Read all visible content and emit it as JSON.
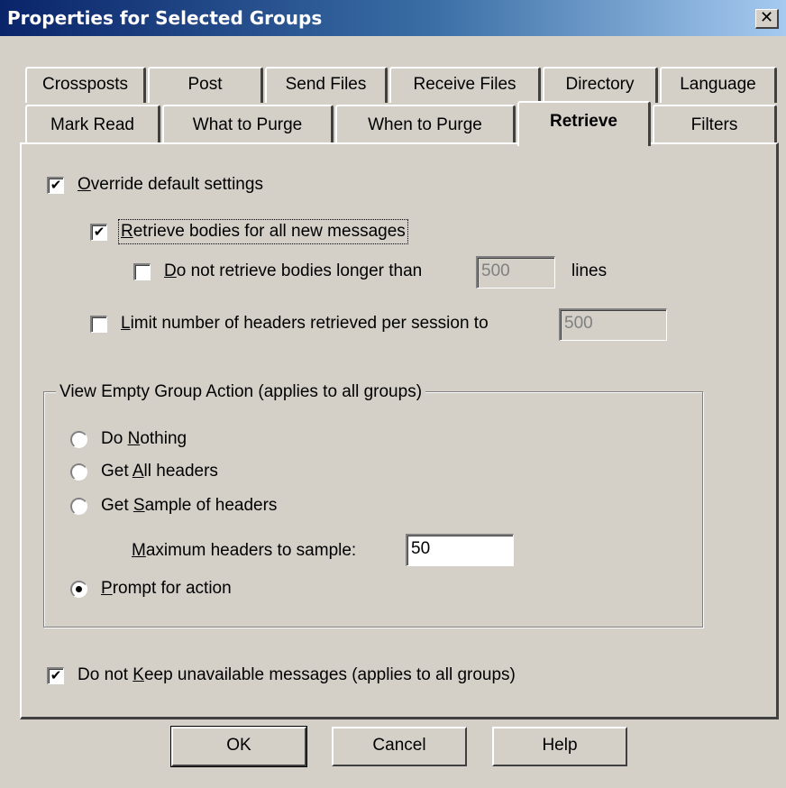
{
  "window": {
    "title": "Properties for Selected Groups",
    "close_glyph": "✕"
  },
  "tabs": {
    "row1": [
      "Crossposts",
      "Post",
      "Send Files",
      "Receive Files",
      "Directory",
      "Language"
    ],
    "row2": [
      "Mark Read",
      "What to Purge",
      "When to Purge",
      "Retrieve",
      "Filters"
    ],
    "active": "Retrieve"
  },
  "retrieve": {
    "override": {
      "label_u": "O",
      "label_rest": "verride default settings",
      "checked": "✔"
    },
    "retrieve_bodies": {
      "label_u": "R",
      "label_rest": "etrieve bodies for all new messages",
      "checked": "✔"
    },
    "limit_body": {
      "label_u": "D",
      "label_rest": "o not retrieve bodies longer than",
      "value": "500",
      "suffix": "lines",
      "checked": ""
    },
    "limit_headers": {
      "label_u": "L",
      "label_rest": "imit number of headers retrieved per session to",
      "value": "500",
      "checked": ""
    }
  },
  "empty_group": {
    "title": "View Empty Group Action (applies to all groups)",
    "options": [
      {
        "pre": "Do ",
        "u": "N",
        "post": "othing",
        "selected": false
      },
      {
        "pre": "Get ",
        "u": "A",
        "post": "ll headers",
        "selected": false
      },
      {
        "pre": "Get ",
        "u": "S",
        "post": "ample of headers",
        "selected": false
      },
      {
        "pre": "",
        "u": "P",
        "post": "rompt for action",
        "selected": true
      }
    ],
    "max_sample": {
      "u": "M",
      "rest": "aximum headers to sample:",
      "value": "50"
    }
  },
  "keep": {
    "pre": "Do not ",
    "u": "K",
    "post": "eep unavailable messages (applies to all groups)",
    "checked": "✔"
  },
  "buttons": {
    "ok": "OK",
    "cancel": "Cancel",
    "help": "Help"
  }
}
